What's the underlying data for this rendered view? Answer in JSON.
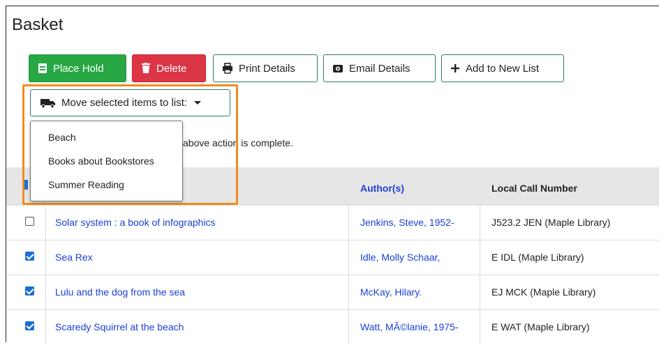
{
  "page": {
    "title": "Basket"
  },
  "toolbar": {
    "place_hold": "Place Hold",
    "delete": "Delete",
    "print_details": "Print Details",
    "email_details": "Email Details",
    "add_to_new_list": "Add to New List"
  },
  "move": {
    "label": "Move selected items to list:",
    "options": [
      "Beach",
      "Books about Bookstores",
      "Summer Reading"
    ]
  },
  "note": {
    "text": "above action is complete."
  },
  "table": {
    "headers": {
      "author": "Author(s)",
      "call": "Local Call Number"
    },
    "rows": [
      {
        "checked": false,
        "title": "Solar system : a book of infographics",
        "author": "Jenkins, Steve, 1952-",
        "call": "J523.2 JEN (Maple Library)"
      },
      {
        "checked": true,
        "title": "Sea Rex",
        "author": "Idle, Molly Schaar,",
        "call": "E IDL (Maple Library)"
      },
      {
        "checked": true,
        "title": "Lulu and the dog from the sea",
        "author": "McKay, Hilary.",
        "call": "EJ MCK (Maple Library)"
      },
      {
        "checked": true,
        "title": "Scaredy Squirrel at the beach",
        "author": "Watt, MÃ©lanie, 1975-",
        "call": "E WAT (Maple Library)"
      }
    ]
  },
  "colors": {
    "green": "#28a745",
    "red": "#dc3545",
    "outline": "#2b7a6e",
    "highlight": "#f08c1e",
    "link": "#1a3fd6",
    "checkbox": "#1a6fd6"
  },
  "icons": {
    "place_hold": "bookmark-icon",
    "delete": "trash-icon",
    "print": "printer-icon",
    "email": "envelope-icon",
    "add": "plus-icon",
    "move": "truck-icon"
  }
}
